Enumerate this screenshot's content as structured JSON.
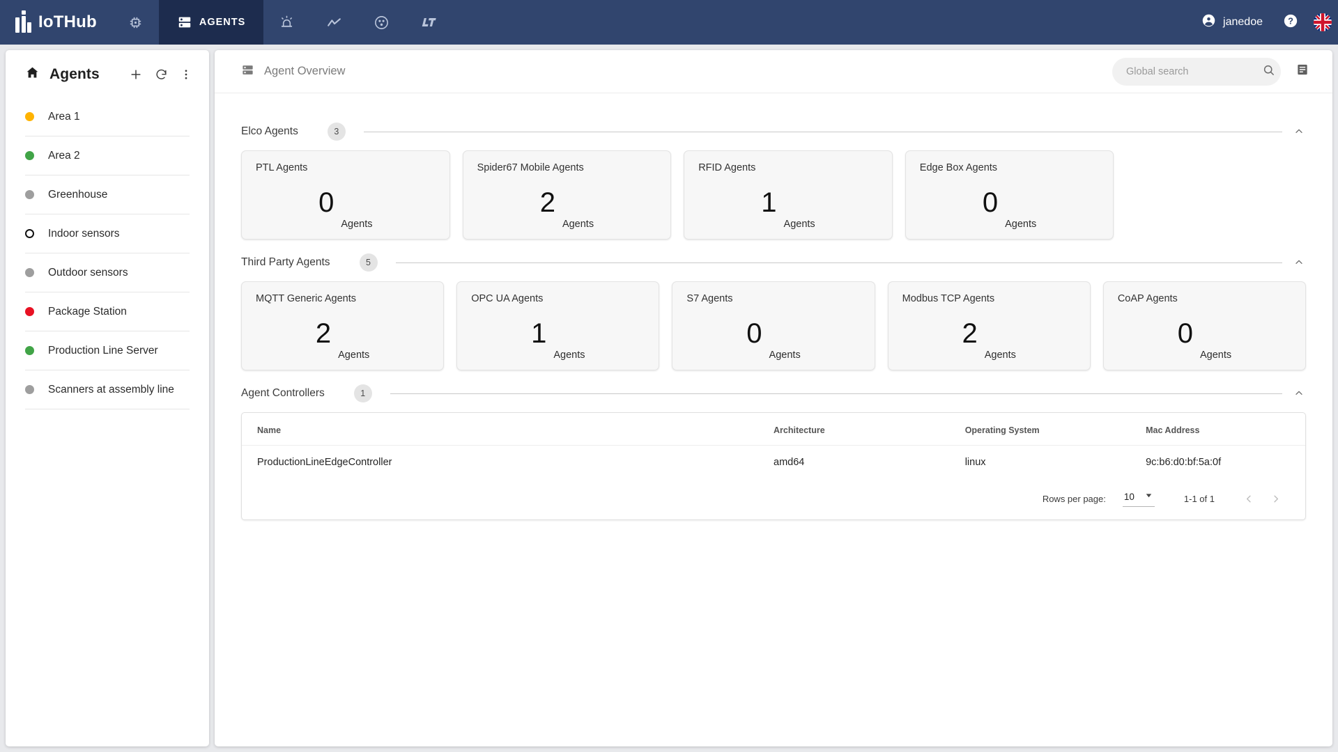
{
  "app": {
    "brand": "IoTHub",
    "nav": [
      {
        "name": "devices",
        "icon": "chip-icon",
        "label": ""
      },
      {
        "name": "agents",
        "icon": "server-rack-icon",
        "label": "AGENTS",
        "active": true
      },
      {
        "name": "alarms",
        "icon": "alarm-siren-icon",
        "label": ""
      },
      {
        "name": "analytics",
        "icon": "line-chart-icon",
        "label": ""
      },
      {
        "name": "users",
        "icon": "people-group-icon",
        "label": ""
      },
      {
        "name": "lt-module",
        "icon": "lt-logo-icon",
        "label": ""
      }
    ],
    "user": "janedoe",
    "help_icon": "help-circle-icon",
    "language_icon": "uk-flag-icon"
  },
  "sidebar": {
    "title": "Agents",
    "home_icon": "home-icon",
    "add_icon": "plus-icon",
    "refresh_icon": "refresh-icon",
    "more_icon": "more-vertical-icon",
    "items": [
      {
        "label": "Area 1",
        "status_color": "#FFB300",
        "hollow": false
      },
      {
        "label": "Area 2",
        "status_color": "#41A447",
        "hollow": false
      },
      {
        "label": "Greenhouse",
        "status_color": "#9E9E9E",
        "hollow": false
      },
      {
        "label": "Indoor sensors",
        "status_color": "#111111",
        "hollow": true
      },
      {
        "label": "Outdoor sensors",
        "status_color": "#9E9E9E",
        "hollow": false
      },
      {
        "label": "Package Station",
        "status_color": "#E81123",
        "hollow": false
      },
      {
        "label": "Production Line Server",
        "status_color": "#41A447",
        "hollow": false
      },
      {
        "label": "Scanners at assembly line",
        "status_color": "#9E9E9E",
        "hollow": false
      }
    ]
  },
  "main": {
    "breadcrumb": "Agent Overview",
    "breadcrumb_icon": "server-rack-icon",
    "search": {
      "placeholder": "Global search",
      "value": "",
      "icon": "search-icon"
    },
    "list_view_icon": "list-view-icon",
    "sections": [
      {
        "title": "Elco Agents",
        "count": "3",
        "chevron": "chevron-up-icon",
        "cards": [
          {
            "title": "PTL Agents",
            "value": "0",
            "unit": "Agents"
          },
          {
            "title": "Spider67 Mobile Agents",
            "value": "2",
            "unit": "Agents"
          },
          {
            "title": "RFID Agents",
            "value": "1",
            "unit": "Agents"
          },
          {
            "title": "Edge Box Agents",
            "value": "0",
            "unit": "Agents"
          }
        ]
      },
      {
        "title": "Third Party Agents",
        "count": "5",
        "chevron": "chevron-up-icon",
        "cards": [
          {
            "title": "MQTT Generic Agents",
            "value": "2",
            "unit": "Agents"
          },
          {
            "title": "OPC UA Agents",
            "value": "1",
            "unit": "Agents"
          },
          {
            "title": "S7 Agents",
            "value": "0",
            "unit": "Agents"
          },
          {
            "title": "Modbus TCP Agents",
            "value": "2",
            "unit": "Agents"
          },
          {
            "title": "CoAP Agents",
            "value": "0",
            "unit": "Agents"
          }
        ]
      }
    ],
    "controllers": {
      "title": "Agent Controllers",
      "count": "1",
      "chevron": "chevron-up-icon",
      "columns": [
        "Name",
        "Architecture",
        "Operating System",
        "Mac Address"
      ],
      "rows": [
        {
          "name": "ProductionLineEdgeController",
          "architecture": "amd64",
          "operating_system": "linux",
          "mac_address": "9c:b6:d0:bf:5a:0f"
        }
      ],
      "pagination": {
        "rows_per_page_label": "Rows per page:",
        "rows_per_page_value": "10",
        "range": "1-1 of 1",
        "prev_icon": "chevron-left-icon",
        "next_icon": "chevron-right-icon"
      }
    }
  },
  "colors": {
    "header": "#31456e",
    "header_active": "#1d2c4e",
    "page_bg": "#e8e9ec",
    "card_bg": "#f7f7f7"
  }
}
